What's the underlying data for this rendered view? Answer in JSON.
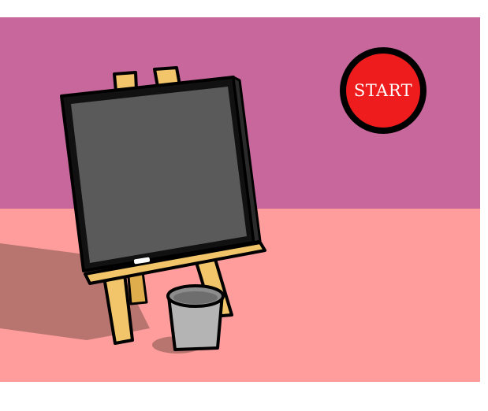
{
  "game": {
    "start_button": {
      "label": "START",
      "color": "#ee1c1c"
    }
  },
  "scene": {
    "wall_color": "#c8679b",
    "floor_color": "#ff9c9c",
    "chalkboard_color": "#5a5a5a",
    "easel_wood_color": "#f2c56a",
    "bucket_color": "#b4b4b4",
    "objects": [
      "chalkboard",
      "easel",
      "chalk",
      "bucket"
    ]
  }
}
